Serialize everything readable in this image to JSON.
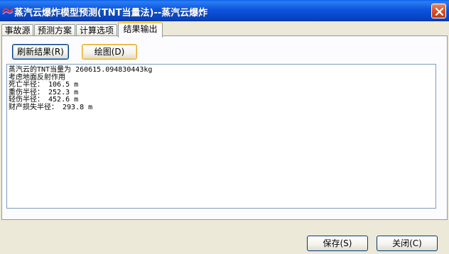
{
  "window": {
    "title": "蒸汽云爆炸模型预测(TNT当量法)--蒸汽云爆炸",
    "icon": "app-icon",
    "close_icon": "close-icon"
  },
  "tabs": [
    {
      "label": "事故源",
      "active": false
    },
    {
      "label": "预测方案",
      "active": false
    },
    {
      "label": "计算选项",
      "active": false
    },
    {
      "label": "结果输出",
      "active": true
    }
  ],
  "actions": {
    "refresh_label": "刷新结果(R)",
    "plot_label": "绘图(D)"
  },
  "results": {
    "lines": [
      "蒸汽云的TNT当量为 260615.094830443kg",
      "考虑地面反射作用",
      "死亡半径： 106.5 m",
      "重伤半径： 252.3 m",
      "轻伤半径： 452.6 m",
      "财产损失半径： 293.8 m"
    ]
  },
  "footer": {
    "save_label": "保存(S)",
    "close_label": "关闭(C)"
  }
}
